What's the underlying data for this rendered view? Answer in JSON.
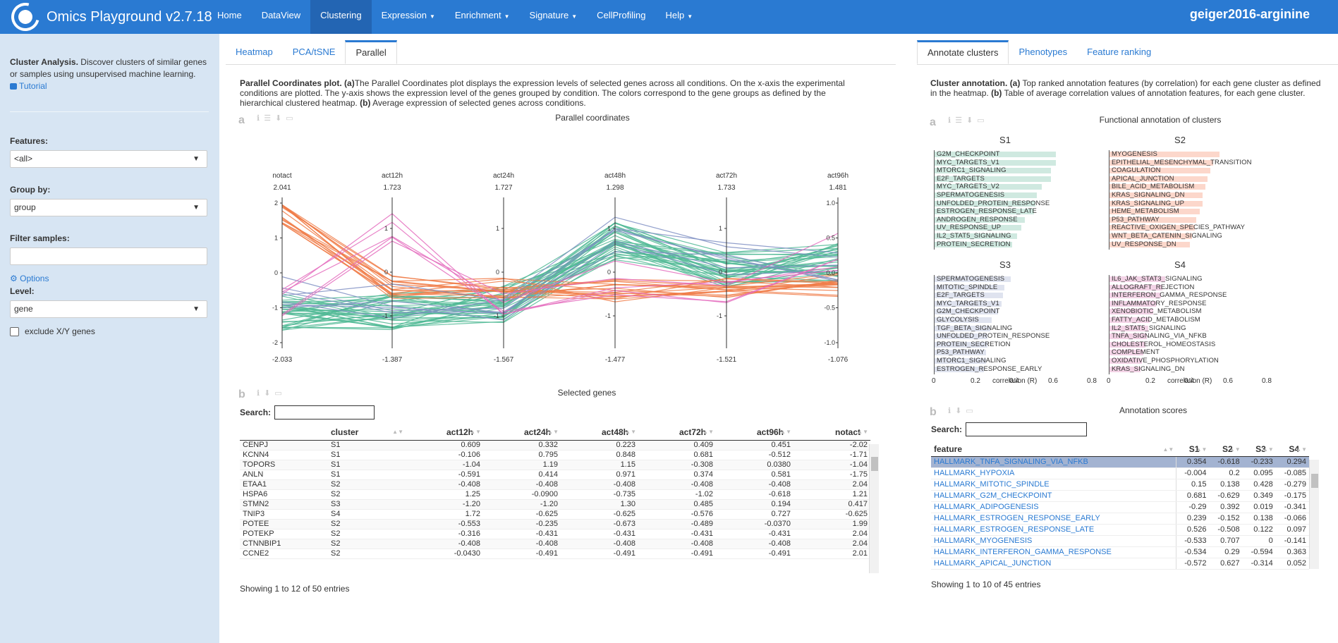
{
  "app": {
    "title": "Omics Playground v2.7.18",
    "dataset": "geiger2016-arginine"
  },
  "nav": [
    {
      "label": "Home",
      "caret": ""
    },
    {
      "label": "DataView",
      "caret": ""
    },
    {
      "label": "Clustering",
      "caret": ""
    },
    {
      "label": "Expression",
      "caret": "▼"
    },
    {
      "label": "Enrichment",
      "caret": "▼"
    },
    {
      "label": "Signature",
      "caret": "▼"
    },
    {
      "label": "CellProfiling",
      "caret": ""
    },
    {
      "label": "Help",
      "caret": "▼"
    }
  ],
  "sidebar": {
    "desc_bold": "Cluster Analysis.",
    "desc_text": " Discover clusters of similar genes or samples using unsupervised machine learning.",
    "tutorial": "Tutorial",
    "features_label": "Features:",
    "features_value": "<all>",
    "group_label": "Group by:",
    "group_value": "group",
    "filter_label": "Filter samples:",
    "options": "Options",
    "level_label": "Level:",
    "level_value": "gene",
    "exclude_label": "exclude X/Y genes"
  },
  "left_tabs": [
    "Heatmap",
    "PCA/tSNE",
    "Parallel"
  ],
  "right_tabs": [
    "Annotate clusters",
    "Phenotypes",
    "Feature ranking"
  ],
  "left_desc": {
    "b1": "Parallel Coordinates plot.",
    "b2": "(a)",
    "t1": "The Parallel Coordinates plot displays the expression levels of selected genes across all conditions. On the x-axis the experimental conditions are plotted. The y-axis shows the expression level of the genes grouped by condition. The colors correspond to the gene groups as defined by the hierarchical clustered heatmap.",
    "b3": "(b)",
    "t2": " Average expression of selected genes across conditions."
  },
  "right_desc": {
    "b1": "Cluster annotation.",
    "b2": "(a)",
    "t1": " Top ranked annotation features (by correlation) for each gene cluster as defined in the heatmap.",
    "b3": "(b)",
    "t2": " Table of average correlation values of annotation features, for each gene cluster."
  },
  "panel_letters": {
    "a": "a",
    "b": "b"
  },
  "parallel": {
    "title": "Parallel coordinates",
    "axes": [
      {
        "name": "notact",
        "max": "2.041",
        "min": "-2.033",
        "ticks": [
          "2",
          "1",
          "0",
          "-1",
          "-2"
        ]
      },
      {
        "name": "act12h",
        "max": "1.723",
        "min": "-1.387",
        "ticks": [
          "1",
          "0",
          "-1"
        ]
      },
      {
        "name": "act24h",
        "max": "1.727",
        "min": "-1.567",
        "ticks": [
          "1",
          "0",
          "-1"
        ]
      },
      {
        "name": "act48h",
        "max": "1.298",
        "min": "-1.477",
        "ticks": [
          "1",
          "0",
          "-1"
        ]
      },
      {
        "name": "act72h",
        "max": "1.733",
        "min": "-1.521",
        "ticks": [
          "1",
          "0",
          "-1"
        ]
      },
      {
        "name": "act96h",
        "max": "1.481",
        "min": "-1.076",
        "ticks": [
          "1.0",
          "0.5",
          "0.0",
          "-0.5",
          "-1.0"
        ]
      }
    ]
  },
  "selected": {
    "title": "Selected genes",
    "search_label": "Search:",
    "columns": [
      "",
      "cluster",
      "act12h",
      "act24h",
      "act48h",
      "act72h",
      "act96h",
      "notact"
    ],
    "rows": [
      [
        "CENPJ",
        "S1",
        "0.609",
        "0.332",
        "0.223",
        "0.409",
        "0.451",
        "-2.02"
      ],
      [
        "KCNN4",
        "S1",
        "-0.106",
        "0.795",
        "0.848",
        "0.681",
        "-0.512",
        "-1.71"
      ],
      [
        "TOPORS",
        "S1",
        "-1.04",
        "1.19",
        "1.15",
        "-0.308",
        "0.0380",
        "-1.04"
      ],
      [
        "ANLN",
        "S1",
        "-0.591",
        "0.414",
        "0.971",
        "0.374",
        "0.581",
        "-1.75"
      ],
      [
        "ETAA1",
        "S2",
        "-0.408",
        "-0.408",
        "-0.408",
        "-0.408",
        "-0.408",
        "2.04"
      ],
      [
        "HSPA6",
        "S2",
        "1.25",
        "-0.0900",
        "-0.735",
        "-1.02",
        "-0.618",
        "1.21"
      ],
      [
        "STMN2",
        "S3",
        "-1.20",
        "-1.20",
        "1.30",
        "0.485",
        "0.194",
        "0.417"
      ],
      [
        "TNIP3",
        "S4",
        "1.72",
        "-0.625",
        "-0.625",
        "-0.576",
        "0.727",
        "-0.625"
      ],
      [
        "POTEE",
        "S2",
        "-0.553",
        "-0.235",
        "-0.673",
        "-0.489",
        "-0.0370",
        "1.99"
      ],
      [
        "POTEKP",
        "S2",
        "-0.316",
        "-0.431",
        "-0.431",
        "-0.431",
        "-0.431",
        "2.04"
      ],
      [
        "CTNNBIP1",
        "S2",
        "-0.408",
        "-0.408",
        "-0.408",
        "-0.408",
        "-0.408",
        "2.04"
      ],
      [
        "CCNE2",
        "S2",
        "-0.0430",
        "-0.491",
        "-0.491",
        "-0.491",
        "-0.491",
        "2.01"
      ]
    ],
    "footer": "Showing 1 to 12 of 50 entries"
  },
  "annotation": {
    "title": "Functional annotation of clusters",
    "xlabel": "correlation (R)",
    "xticks": [
      "0",
      "0.2",
      "0.4",
      "0.6",
      "0.8"
    ],
    "clusters": [
      {
        "name": "S1",
        "color": "#cfe9e0",
        "items": [
          {
            "label": "G2M_CHECKPOINT",
            "v": 0.78
          },
          {
            "label": "MYC_TARGETS_V1",
            "v": 0.78
          },
          {
            "label": "MTORC1_SIGNALING",
            "v": 0.75
          },
          {
            "label": "E2F_TARGETS",
            "v": 0.75
          },
          {
            "label": "MYC_TARGETS_V2",
            "v": 0.69
          },
          {
            "label": "SPERMATOGENESIS",
            "v": 0.66
          },
          {
            "label": "UNFOLDED_PROTEIN_RESPONSE",
            "v": 0.65
          },
          {
            "label": "ESTROGEN_RESPONSE_LATE",
            "v": 0.64
          },
          {
            "label": "ANDROGEN_RESPONSE",
            "v": 0.58
          },
          {
            "label": "UV_RESPONSE_UP",
            "v": 0.56
          },
          {
            "label": "IL2_STAT5_SIGNALING",
            "v": 0.53
          },
          {
            "label": "PROTEIN_SECRETION",
            "v": 0.5
          }
        ]
      },
      {
        "name": "S2",
        "color": "#fcd7cb",
        "items": [
          {
            "label": "MYOGENESIS",
            "v": 0.71
          },
          {
            "label": "EPITHELIAL_MESENCHYMAL_TRANSITION",
            "v": 0.67
          },
          {
            "label": "COAGULATION",
            "v": 0.65
          },
          {
            "label": "APICAL_JUNCTION",
            "v": 0.63
          },
          {
            "label": "BILE_ACID_METABOLISM",
            "v": 0.62
          },
          {
            "label": "KRAS_SIGNALING_DN",
            "v": 0.6
          },
          {
            "label": "KRAS_SIGNALING_UP",
            "v": 0.6
          },
          {
            "label": "HEME_METABOLISM",
            "v": 0.58
          },
          {
            "label": "P53_PATHWAY",
            "v": 0.56
          },
          {
            "label": "REACTIVE_OXIGEN_SPECIES_PATHWAY",
            "v": 0.55
          },
          {
            "label": "WNT_BETA_CATENIN_SIGNALING",
            "v": 0.53
          },
          {
            "label": "UV_RESPONSE_DN",
            "v": 0.52
          }
        ]
      },
      {
        "name": "S3",
        "color": "#dfe3ef",
        "items": [
          {
            "label": "SPERMATOGENESIS",
            "v": 0.49
          },
          {
            "label": "MITOTIC_SPINDLE",
            "v": 0.45
          },
          {
            "label": "E2F_TARGETS",
            "v": 0.44
          },
          {
            "label": "MYC_TARGETS_V1",
            "v": 0.43
          },
          {
            "label": "G2M_CHECKPOINT",
            "v": 0.41
          },
          {
            "label": "GLYCOLYSIS",
            "v": 0.37
          },
          {
            "label": "TGF_BETA_SIGNALING",
            "v": 0.36
          },
          {
            "label": "UNFOLDED_PROTEIN_RESPONSE",
            "v": 0.34
          },
          {
            "label": "PROTEIN_SECRETION",
            "v": 0.34
          },
          {
            "label": "P53_PATHWAY",
            "v": 0.33
          },
          {
            "label": "MTORC1_SIGNALING",
            "v": 0.33
          },
          {
            "label": "ESTROGEN_RESPONSE_EARLY",
            "v": 0.32
          }
        ]
      },
      {
        "name": "S4",
        "color": "#f3d3e6",
        "items": [
          {
            "label": "IL6_JAK_STAT3_SIGNALING",
            "v": 0.36
          },
          {
            "label": "ALLOGRAFT_REJECTION",
            "v": 0.34
          },
          {
            "label": "INTERFERON_GAMMA_RESPONSE",
            "v": 0.33
          },
          {
            "label": "INFLAMMATORY_RESPONSE",
            "v": 0.3
          },
          {
            "label": "XENOBIOTIC_METABOLISM",
            "v": 0.28
          },
          {
            "label": "FATTY_ACID_METABOLISM",
            "v": 0.26
          },
          {
            "label": "IL2_STAT5_SIGNALING",
            "v": 0.25
          },
          {
            "label": "TNFA_SIGNALING_VIA_NFKB",
            "v": 0.24
          },
          {
            "label": "CHOLESTEROL_HOMEOSTASIS",
            "v": 0.23
          },
          {
            "label": "COMPLEMENT",
            "v": 0.22
          },
          {
            "label": "OXIDATIVE_PHOSPHORYLATION",
            "v": 0.21
          },
          {
            "label": "KRAS_SIGNALING_DN",
            "v": 0.2
          }
        ]
      }
    ]
  },
  "scores": {
    "title": "Annotation scores",
    "search_label": "Search:",
    "columns": [
      "feature",
      "S1",
      "S2",
      "S3",
      "S4"
    ],
    "rows": [
      [
        "HALLMARK_TNFA_SIGNALING_VIA_NFKB",
        "0.354",
        "-0.618",
        "-0.233",
        "0.294"
      ],
      [
        "HALLMARK_HYPOXIA",
        "-0.004",
        "0.2",
        "0.095",
        "-0.085"
      ],
      [
        "HALLMARK_MITOTIC_SPINDLE",
        "0.15",
        "0.138",
        "0.428",
        "-0.279"
      ],
      [
        "HALLMARK_G2M_CHECKPOINT",
        "0.681",
        "-0.629",
        "0.349",
        "-0.175"
      ],
      [
        "HALLMARK_ADIPOGENESIS",
        "-0.29",
        "0.392",
        "0.019",
        "-0.341"
      ],
      [
        "HALLMARK_ESTROGEN_RESPONSE_EARLY",
        "0.239",
        "-0.152",
        "0.138",
        "-0.066"
      ],
      [
        "HALLMARK_ESTROGEN_RESPONSE_LATE",
        "0.526",
        "-0.508",
        "0.122",
        "0.097"
      ],
      [
        "HALLMARK_MYOGENESIS",
        "-0.533",
        "0.707",
        "0",
        "-0.141"
      ],
      [
        "HALLMARK_INTERFERON_GAMMA_RESPONSE",
        "-0.534",
        "0.29",
        "-0.594",
        "0.363"
      ],
      [
        "HALLMARK_APICAL_JUNCTION",
        "-0.572",
        "0.627",
        "-0.314",
        "0.052"
      ]
    ],
    "footer": "Showing 1 to 10 of 45 entries"
  },
  "colors": {
    "brand": "#2a7ad2",
    "sidebar": "#d7e5f3",
    "S1": "#4fb894",
    "S2": "#f07a45",
    "S3": "#7f8fc3",
    "S4": "#e46bbd"
  }
}
